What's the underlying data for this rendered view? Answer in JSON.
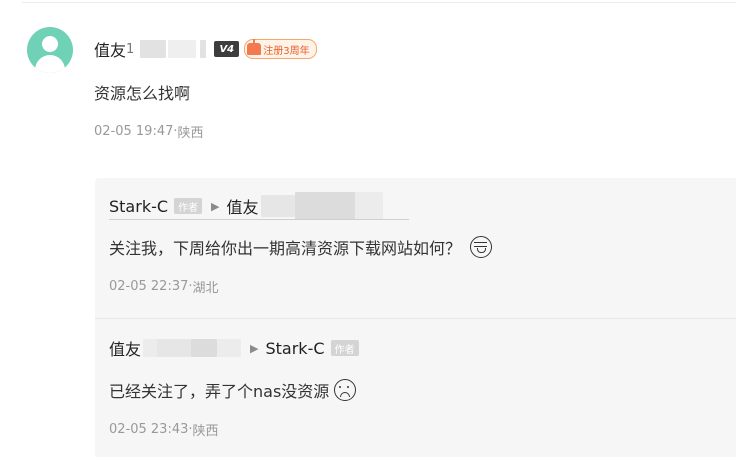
{
  "comment": {
    "user": {
      "name_prefix": "值友",
      "name_partial": "1",
      "level": "V4",
      "anniversary": "注册3周年"
    },
    "text": "资源怎么找啊",
    "time": "02-05 19:47",
    "location": "陕西"
  },
  "replies": [
    {
      "author": "Stark-C",
      "author_tag": "作者",
      "to": "值友",
      "text": "关注我，下周给你出一期高清资源下载网站如何？",
      "emoji": "grin-icon",
      "time": "02-05 22:37",
      "location": "湖北"
    },
    {
      "author": "值友",
      "to": "Stark-C",
      "to_tag": "作者",
      "text": "已经关注了，弄了个nas没资源",
      "emoji": "sad-face-icon",
      "time": "02-05 23:43",
      "location": "陕西"
    }
  ],
  "separator": " · "
}
